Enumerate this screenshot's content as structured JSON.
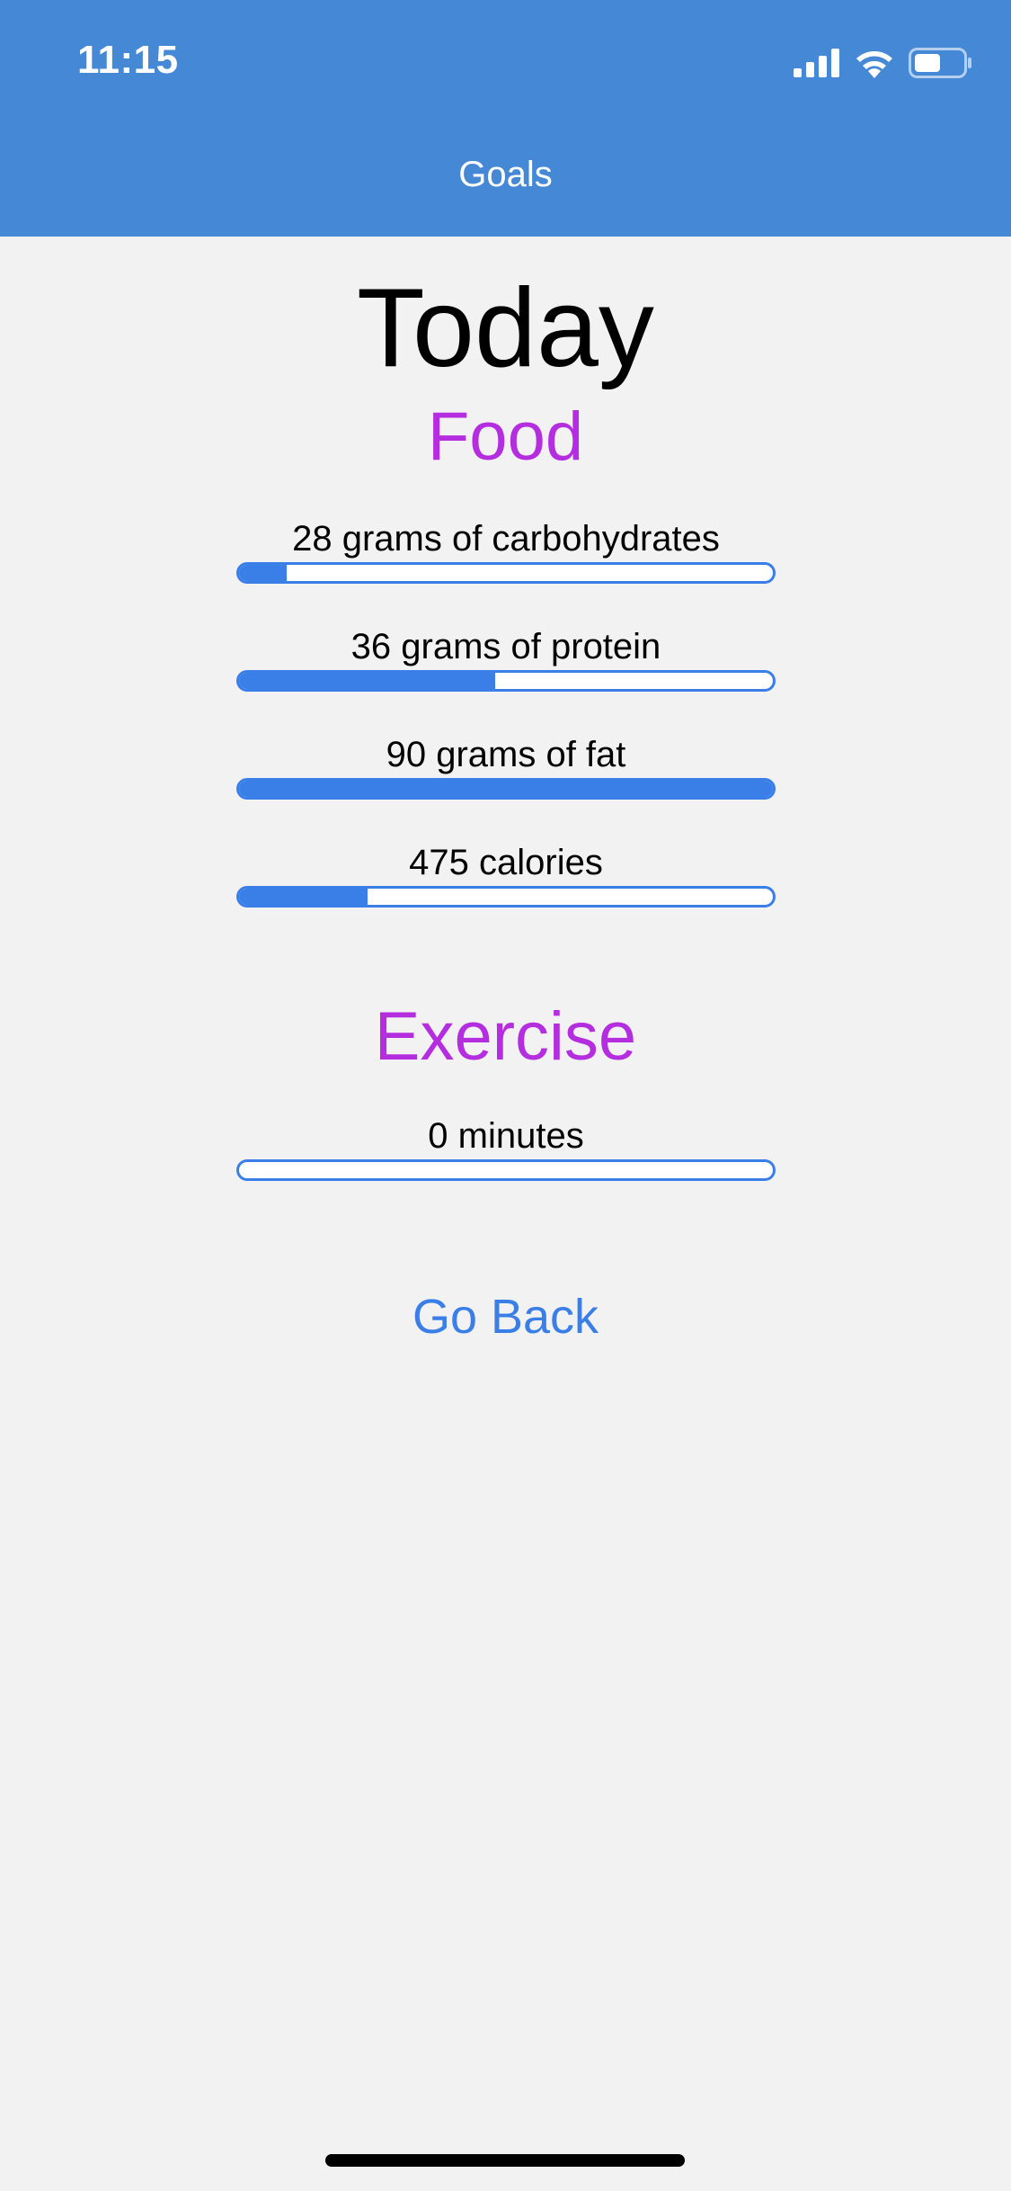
{
  "status_bar": {
    "time": "11:15",
    "icons": [
      "signal-icon",
      "wifi-icon",
      "battery-icon"
    ]
  },
  "nav": {
    "title": "Goals"
  },
  "main": {
    "heading": "Today",
    "food": {
      "title": "Food",
      "goals": [
        {
          "label": "28 grams of carbohydrates",
          "progress": 0.09
        },
        {
          "label": "36 grams of protein",
          "progress": 0.48
        },
        {
          "label": "90 grams of fat",
          "progress": 1.0
        },
        {
          "label": "475 calories",
          "progress": 0.24
        }
      ]
    },
    "exercise": {
      "title": "Exercise",
      "goals": [
        {
          "label": "0 minutes",
          "progress": 0.0
        }
      ]
    },
    "back_label": "Go Back"
  },
  "colors": {
    "header": "#4488d6",
    "section_title": "#b42ee0",
    "progress": "#3a7ee8",
    "background": "#f2f2f2"
  }
}
